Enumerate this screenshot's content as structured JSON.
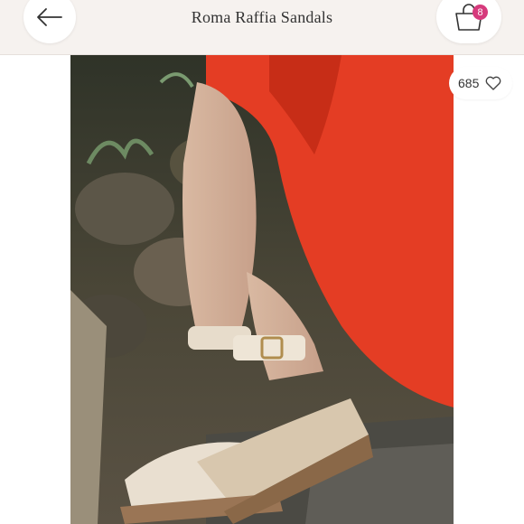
{
  "header": {
    "title": "Roma Raffia Sandals",
    "back_icon": "arrow-left-icon",
    "cart_icon": "shopping-bag-icon",
    "cart_count": "8",
    "badge_color": "#d63a7c"
  },
  "listing": {
    "likes": "685",
    "like_icon": "heart-outline-icon",
    "photo_subject": "product-photo"
  }
}
